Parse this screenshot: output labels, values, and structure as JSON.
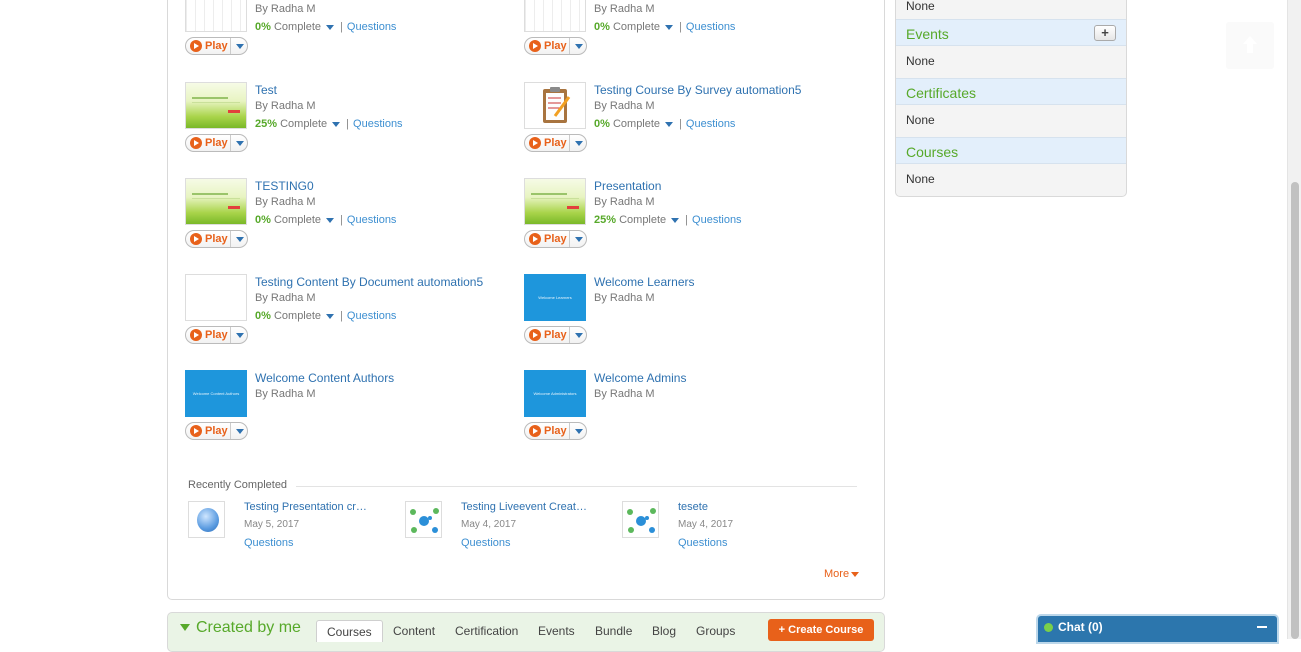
{
  "courses": [
    {
      "title": "",
      "author": "By Radha M",
      "percent": "0%",
      "complete_label": "Complete",
      "questions_label": "Questions",
      "play_label": "Play",
      "thumb": "grid"
    },
    {
      "title": "",
      "author": "By Radha M",
      "percent": "0%",
      "complete_label": "Complete",
      "questions_label": "Questions",
      "play_label": "Play",
      "thumb": "grid"
    },
    {
      "title": "Test",
      "author": "By Radha M",
      "percent": "25%",
      "complete_label": "Complete",
      "questions_label": "Questions",
      "play_label": "Play",
      "thumb": "green"
    },
    {
      "title": "Testing Course By Survey automation5",
      "author": "By Radha M",
      "percent": "0%",
      "complete_label": "Complete",
      "questions_label": "Questions",
      "play_label": "Play",
      "thumb": "clipboard-icon"
    },
    {
      "title": "TESTING0",
      "author": "By Radha M",
      "percent": "0%",
      "complete_label": "Complete",
      "questions_label": "Questions",
      "play_label": "Play",
      "thumb": "green"
    },
    {
      "title": "Presentation",
      "author": "By Radha M",
      "percent": "25%",
      "complete_label": "Complete",
      "questions_label": "Questions",
      "play_label": "Play",
      "thumb": "green"
    },
    {
      "title": "Testing Content By Document automation5",
      "author": "By Radha M",
      "percent": "0%",
      "complete_label": "Complete",
      "questions_label": "Questions",
      "play_label": "Play",
      "thumb": "white"
    },
    {
      "title": "Welcome Learners",
      "author": "By Radha M",
      "play_label": "Play",
      "thumb": "blue",
      "thumb_text": "Welcome Learners"
    },
    {
      "title": "Welcome Content Authors",
      "author": "By Radha M",
      "play_label": "Play",
      "thumb": "blue",
      "thumb_text": "Welcome Content Authors"
    },
    {
      "title": "Welcome Admins",
      "author": "By Radha M",
      "play_label": "Play",
      "thumb": "blue",
      "thumb_text": "Welcome Administrators"
    }
  ],
  "recently_completed": {
    "label": "Recently Completed",
    "items": [
      {
        "title": "Testing Presentation cr…",
        "date": "May 5, 2017",
        "questions_label": "Questions",
        "icon": "globe-icon"
      },
      {
        "title": "Testing Liveevent Creat…",
        "date": "May 4, 2017",
        "questions_label": "Questions",
        "icon": "network-icon"
      },
      {
        "title": "tesete",
        "date": "May 4, 2017",
        "questions_label": "Questions",
        "icon": "network-icon"
      }
    ],
    "more_label": "More"
  },
  "created_by_me": {
    "title": "Created by me",
    "tabs": [
      "Courses",
      "Content",
      "Certification",
      "Events",
      "Bundle",
      "Blog",
      "Groups"
    ],
    "active_tab": "Courses",
    "create_button": "+ Create Course"
  },
  "sidebar": {
    "top_value": "None",
    "sections": [
      {
        "title": "Events",
        "value": "None",
        "has_add": true,
        "add_label": "+"
      },
      {
        "title": "Certificates",
        "value": "None"
      },
      {
        "title": "Courses",
        "value": "None"
      }
    ]
  },
  "chat": {
    "label": "Chat  (0)"
  },
  "colors": {
    "accent_orange": "#e8611a",
    "green": "#57a92a",
    "link_blue": "#2f72b0",
    "chat_blue": "#2c76ad"
  }
}
